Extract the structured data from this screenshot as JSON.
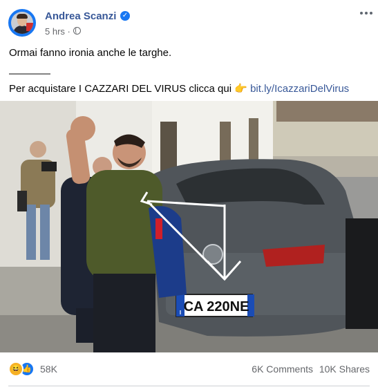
{
  "post": {
    "author": "Andrea Scanzi",
    "time": "5 hrs",
    "separator": "·",
    "text_line1": "Ormai fanno ironia anche le targhe.",
    "text_rule": "————",
    "text_line3_prefix": "Per acquistare I CAZZARI DEL VIRUS clicca qui",
    "text_line3_emoji": "👉",
    "text_link": "bit.ly/IcazzariDelVirus"
  },
  "photo": {
    "plate_text": "CA 220NE",
    "plate_badge": "I"
  },
  "stats": {
    "reactions_count": "58K",
    "comments": "6K Comments",
    "shares": "10K Shares"
  },
  "icons": {
    "verified": "verified-badge-icon",
    "globe": "globe-icon",
    "menu": "more-options-icon",
    "haha": "haha-reaction-icon",
    "like": "like-reaction-icon"
  },
  "colors": {
    "author_link": "#385898",
    "verified": "#1877f2",
    "secondary_text": "#65676b"
  }
}
